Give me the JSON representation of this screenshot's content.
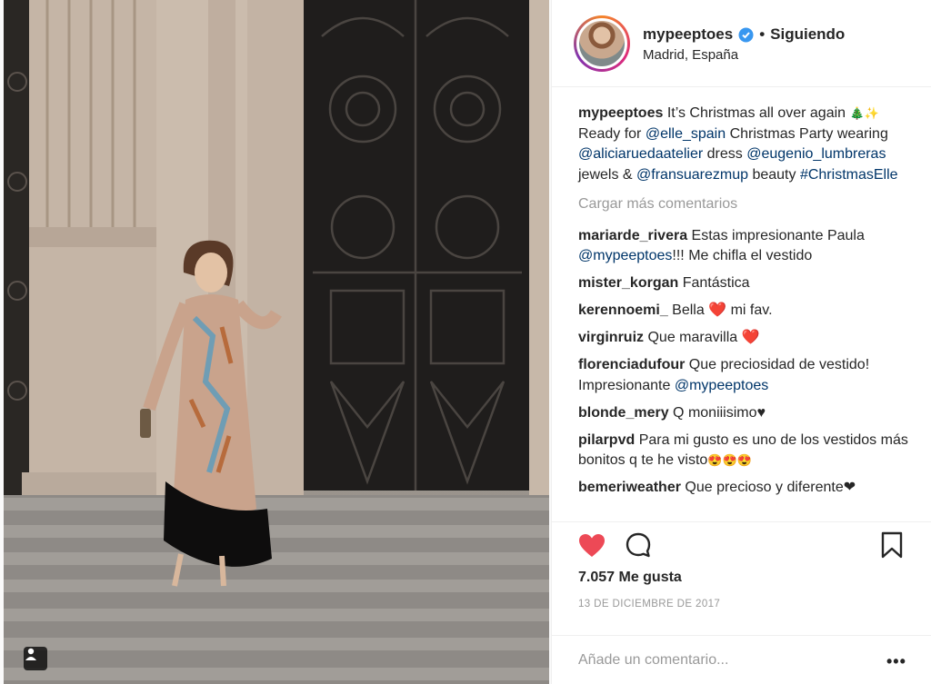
{
  "header": {
    "username": "mypeeptoes",
    "follow_state": "Siguiendo",
    "separator": "•",
    "location": "Madrid, España"
  },
  "caption": {
    "user": "mypeeptoes",
    "text_1": "It’s Christmas all over again",
    "emoji": "🎄✨",
    "text_2": "Ready for",
    "mention_1": "@elle_spain",
    "text_3": "Christmas Party wearing",
    "mention_2": "@aliciaruedaatelier",
    "text_4": "dress",
    "mention_3": "@eugenio_lumbreras",
    "text_5": "jewels &",
    "mention_4": "@fransuarezmup",
    "text_6": "beauty",
    "hashtag": "#ChristmasElle"
  },
  "load_more": "Cargar más comentarios",
  "comments": [
    {
      "user": "mariarde_rivera",
      "text": "Estas impresionante Paula",
      "mention": "@mypeeptoes",
      "text_after": "!!! Me chifla el vestido"
    },
    {
      "user": "mister_korgan",
      "text": "Fantástica"
    },
    {
      "user": "kerennoemi_",
      "text": "Bella",
      "heart": "❤️",
      "text_after": "mi fav."
    },
    {
      "user": "virginruiz",
      "text": "Que maravilla",
      "heart": "❤️"
    },
    {
      "user": "florenciadufour",
      "text": "Que preciosidad de vestido! Impresionante",
      "mention": "@mypeeptoes"
    },
    {
      "user": "blonde_mery",
      "text": "Q moniiisimo♥"
    },
    {
      "user": "pilarpvd",
      "text": "Para mi gusto es uno de los vestidos más bonitos q te he visto",
      "emoji": "😍😍😍"
    },
    {
      "user": "bemeriweather",
      "text": "Que precioso y diferente❤"
    }
  ],
  "actions": {
    "likes": "7.057 Me gusta",
    "date": "13 DE DICIEMBRE DE 2017",
    "like_icon": "heart-filled-icon",
    "comment_icon": "speech-bubble-icon",
    "save_icon": "bookmark-icon"
  },
  "add_comment": {
    "placeholder": "Añade un comentario...",
    "more_icon": "•••"
  },
  "colors": {
    "like": "#ed4956",
    "mention": "#003569",
    "muted": "#999999",
    "text": "#262626",
    "verified": "#3897f0"
  }
}
